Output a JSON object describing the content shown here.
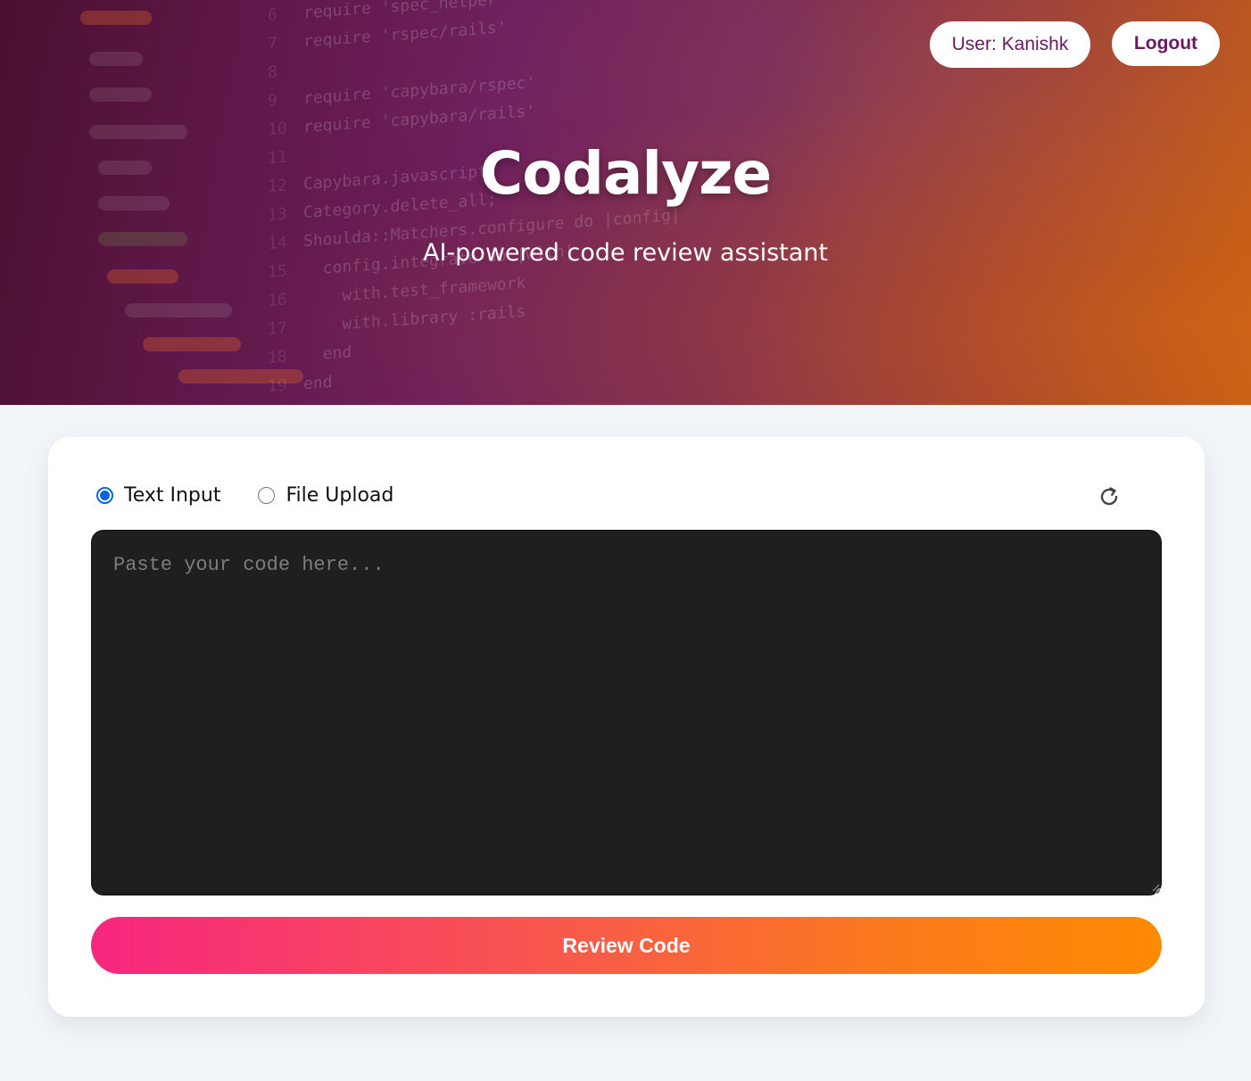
{
  "header": {
    "user_label": "User: Kanishk",
    "logout_label": "Logout",
    "title": "Codalyze",
    "subtitle": "AI-powered code review assistant"
  },
  "background_code": [
    {
      "ln": "6",
      "text": "require 'spec_helper'"
    },
    {
      "ln": "7",
      "text": "require 'rspec/rails'"
    },
    {
      "ln": "8",
      "text": ""
    },
    {
      "ln": "9",
      "text": "require 'capybara/rspec'"
    },
    {
      "ln": "10",
      "text": "require 'capybara/rails'"
    },
    {
      "ln": "11",
      "text": ""
    },
    {
      "ln": "12",
      "text": "Capybara.javascript_"
    },
    {
      "ln": "13",
      "text": "Category.delete_all;"
    },
    {
      "ln": "14",
      "text": "Shoulda::Matchers.configure do |config|"
    },
    {
      "ln": "15",
      "text": "  config.integrate do |with|"
    },
    {
      "ln": "16",
      "text": "    with.test_framework"
    },
    {
      "ln": "17",
      "text": "    with.library :rails"
    },
    {
      "ln": "18",
      "text": "  end"
    },
    {
      "ln": "19",
      "text": "end"
    }
  ],
  "input_mode": {
    "options": [
      {
        "label": "Text Input",
        "checked": true
      },
      {
        "label": "File Upload",
        "checked": false
      }
    ]
  },
  "editor": {
    "placeholder": "Paste your code here...",
    "value": ""
  },
  "actions": {
    "review_label": "Review Code"
  },
  "colors": {
    "brand_text": "#6a1a5e",
    "radio_accent": "#0a66d6",
    "button_gradient_start": "#f7267f",
    "button_gradient_end": "#fd8a02",
    "editor_bg": "#1f1f1f"
  }
}
